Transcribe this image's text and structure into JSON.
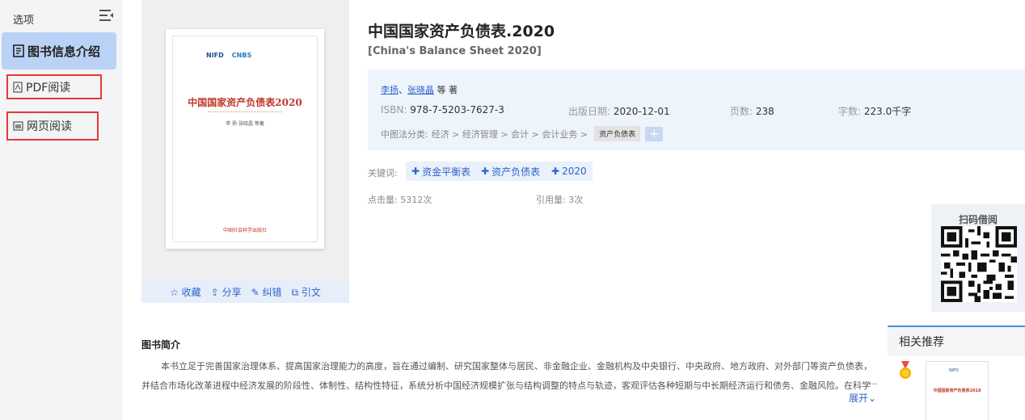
{
  "sidebar": {
    "header": "选项",
    "items": [
      {
        "label": "图书信息介绍",
        "icon": "book-info-icon"
      },
      {
        "label": "PDF阅读",
        "icon": "pdf-icon"
      },
      {
        "label": "网页阅读",
        "icon": "web-page-icon"
      }
    ]
  },
  "cover": {
    "logo_left": "NIFD",
    "logo_right": "CNBS",
    "title": "中国国家资产负债表2020",
    "authors": "李 扬  张晓晶  等著",
    "publisher": "中国社会科学出版社",
    "actions": [
      {
        "label": "收藏",
        "icon": "star-icon"
      },
      {
        "label": "分享",
        "icon": "share-icon"
      },
      {
        "label": "纠错",
        "icon": "edit-icon"
      },
      {
        "label": "引文",
        "icon": "quote-icon"
      }
    ]
  },
  "book": {
    "title": "中国国家资产负债表.2020",
    "subtitle": "[China's Balance Sheet 2020]",
    "author1": "李扬",
    "author_sep": "、",
    "author2": "张晓晶",
    "author_suffix": " 等 著",
    "isbn_label": "ISBN:",
    "isbn": "978-7-5203-7627-3",
    "date_label": "出版日期:",
    "date": "2020-12-01",
    "pages_label": "页数:",
    "pages": "238",
    "words_label": "字数:",
    "words": "223.0千字",
    "class_label": "中图法分类:",
    "class_path": "经济 > 经济管理 > 会计 > 会计业务 >",
    "class_tag": "资产负债表",
    "class_plus": "+",
    "keywords_label": "关键词:",
    "keywords": [
      "资金平衡表",
      "资产负债表",
      "2020"
    ],
    "clicks": "点击量: 5312次",
    "citations": "引用量: 3次"
  },
  "qr": {
    "title": "扫码借阅"
  },
  "intro": {
    "title": "图书简介",
    "text": "本书立足于完善国家治理体系、提高国家治理能力的高度，旨在通过编制、研究国家整体与居民、非金融企业、金融机构及中央银行、中央政府、地方政府、对外部门等资产负债表，并结合市场化改革进程中经济发展的阶段性、体制性、结构性特征，系统分析中国经济规模扩张与结构调整的特点与轨迹，客观评估各种短期与中长期经济运行和债务、金融风险。在科学估",
    "ellipsis": "...",
    "expand": "展开"
  },
  "related": {
    "title": "相关推荐",
    "item_title": "中国国家资产负债表2018",
    "item_logo": "NIFD"
  }
}
